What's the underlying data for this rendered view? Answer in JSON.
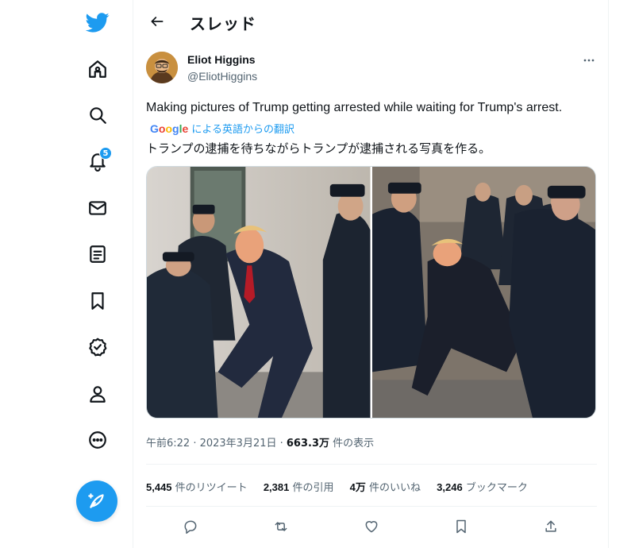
{
  "nav": {
    "items": [
      {
        "name": "twitter-logo-icon"
      },
      {
        "name": "home-icon"
      },
      {
        "name": "explore-search-icon"
      },
      {
        "name": "notifications-bell-icon",
        "badge": "5"
      },
      {
        "name": "messages-envelope-icon"
      },
      {
        "name": "lists-icon"
      },
      {
        "name": "bookmarks-icon"
      },
      {
        "name": "verified-icon"
      },
      {
        "name": "profile-icon"
      },
      {
        "name": "more-circle-icon"
      }
    ],
    "compose_icon": "compose-feather-icon",
    "accent_color": "#1d9bf0"
  },
  "header": {
    "title": "スレッド"
  },
  "tweet": {
    "author_name": "Eliot Higgins",
    "author_handle": "@EliotHiggins",
    "text": "Making pictures of Trump getting arrested while waiting for Trump's arrest.",
    "translate": {
      "google": "Google",
      "label": "による英語からの翻訳"
    },
    "translated_text": "トランプの逮捕を待ちながらトランプが逮捕される写真を作る。",
    "timestamp": "午前6:22 · 2023年3月21日 · ",
    "views_count": "663.3万",
    "views_label": " 件の表示",
    "stats": [
      {
        "count": "5,445",
        "label": " 件のリツイート"
      },
      {
        "count": "2,381",
        "label": " 件の引用"
      },
      {
        "count": "4万",
        "label": " 件のいいね"
      },
      {
        "count": "3,246",
        "label": " ブックマーク"
      }
    ]
  }
}
